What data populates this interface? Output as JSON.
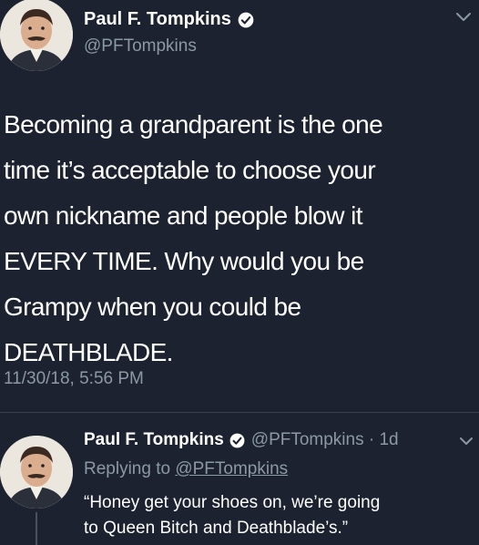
{
  "main_tweet": {
    "display_name": "Paul F. Tompkins",
    "handle": "@PFTompkins",
    "text_lines": [
      "Becoming a grandparent is the one",
      "time it’s acceptable to choose your",
      "own nickname and people blow it",
      "EVERY TIME. Why would you be",
      "Grampy when you could be",
      "DEATHBLADE."
    ],
    "timestamp": "11/30/18, 5:56 PM",
    "verified_icon": "verified-badge-icon",
    "menu_icon": "chevron-down-icon"
  },
  "reply_tweet": {
    "display_name": "Paul F. Tompkins",
    "handle_time": "@PFTompkins · 1d",
    "replying_prefix": "Replying to",
    "replying_handle": "@PFTompkins",
    "text_lines": [
      "“Honey get your shoes on, we’re going",
      "to Queen Bitch and Deathblade’s.”"
    ]
  },
  "colors": {
    "background": "#1c2230",
    "text": "#ffffff",
    "secondary_text": "#8b98a5",
    "divider": "#38404d"
  }
}
